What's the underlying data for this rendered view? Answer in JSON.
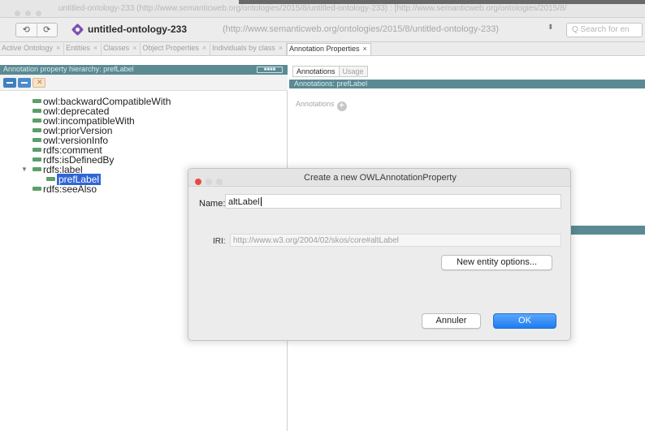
{
  "window": {
    "title": "untitled-ontology-233 (http://www.semanticweb.org/ontologies/2015/8/untitled-ontology-233) : [http://www.semanticweb.org/ontologies/2015/8/"
  },
  "toolbar": {
    "back_glyph": "⟲",
    "forward_glyph": "⟳",
    "ontology_name": "untitled-ontology-233",
    "ontology_iri": "(http://www.semanticweb.org/ontologies/2015/8/untitled-ontology-233)",
    "dropdown_glyph": "⬍",
    "search_placeholder": "Q Search for en"
  },
  "tabs": [
    {
      "label": "Active Ontology",
      "close": "×"
    },
    {
      "label": "Entities",
      "close": "×"
    },
    {
      "label": "Classes",
      "close": "×"
    },
    {
      "label": "Object Properties",
      "close": "×"
    },
    {
      "label": "Individuals by class",
      "close": "×"
    },
    {
      "label": "Annotation Properties",
      "close": "×",
      "active": true
    }
  ],
  "left_panel": {
    "title": "Annotation property hierarchy: prefLabel",
    "badge": "■■■■",
    "tree": [
      {
        "label": "owl:backwardCompatibleWith",
        "depth": 0
      },
      {
        "label": "owl:deprecated",
        "depth": 0
      },
      {
        "label": "owl:incompatibleWith",
        "depth": 0
      },
      {
        "label": "owl:priorVersion",
        "depth": 0
      },
      {
        "label": "owl:versionInfo",
        "depth": 0
      },
      {
        "label": "rdfs:comment",
        "depth": 0
      },
      {
        "label": "rdfs:isDefinedBy",
        "depth": 0
      },
      {
        "label": "rdfs:label",
        "depth": 0,
        "expanded": true
      },
      {
        "label": "prefLabel",
        "depth": 1,
        "selected": true
      },
      {
        "label": "rdfs:seeAlso",
        "depth": 0
      }
    ],
    "expand_glyph": "▼"
  },
  "right_panel": {
    "tabs": [
      "Annotations",
      "Usage"
    ],
    "header": "Annotations: prefLabel",
    "annotations_label": "Annotations",
    "add_glyph": "+"
  },
  "dialog": {
    "title": "Create a new OWLAnnotationProperty",
    "name_label": "Name:",
    "name_value": "altLabel",
    "iri_label": "IRI:",
    "iri_value": "http://www.w3.org/2004/02/skos/core#altLabel",
    "new_entity_options": "New entity options...",
    "cancel": "Annuler",
    "ok": "OK"
  },
  "colors": {
    "header_teal": "#5b8a93",
    "selection_blue": "#2f65d6",
    "ok_blue": "#1e7cf0",
    "property_green": "#5d9e6a",
    "close_red": "#e94c3c"
  }
}
